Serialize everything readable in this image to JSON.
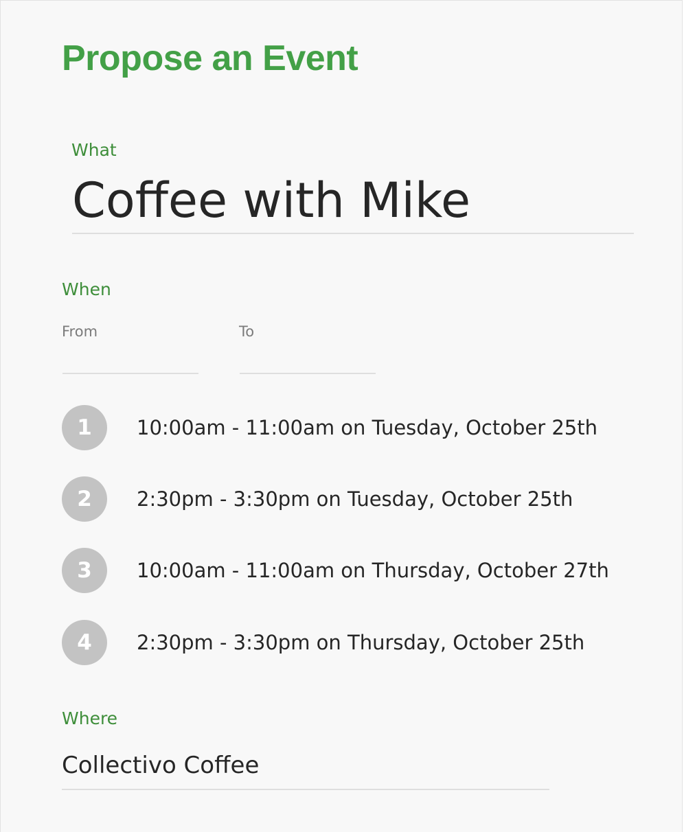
{
  "theme": {
    "title_color": "#43a047",
    "label_color": "#3e8e3a",
    "badge_color": "#c3c3c3",
    "divider_color": "#dedede"
  },
  "page": {
    "title": "Propose an Event"
  },
  "what": {
    "label": "What",
    "value": "Coffee with Mike"
  },
  "when": {
    "label": "When",
    "from_label": "From",
    "from_value": "",
    "to_label": "To",
    "to_value": "",
    "options": [
      {
        "number": "1",
        "text": "10:00am - 11:00am on Tuesday, October 25th"
      },
      {
        "number": "2",
        "text": "2:30pm - 3:30pm on Tuesday, October 25th"
      },
      {
        "number": "3",
        "text": "10:00am - 11:00am on Thursday, October 27th"
      },
      {
        "number": "4",
        "text": "2:30pm - 3:30pm on Thursday, October 25th"
      }
    ]
  },
  "where": {
    "label": "Where",
    "value": "Collectivo Coffee"
  }
}
